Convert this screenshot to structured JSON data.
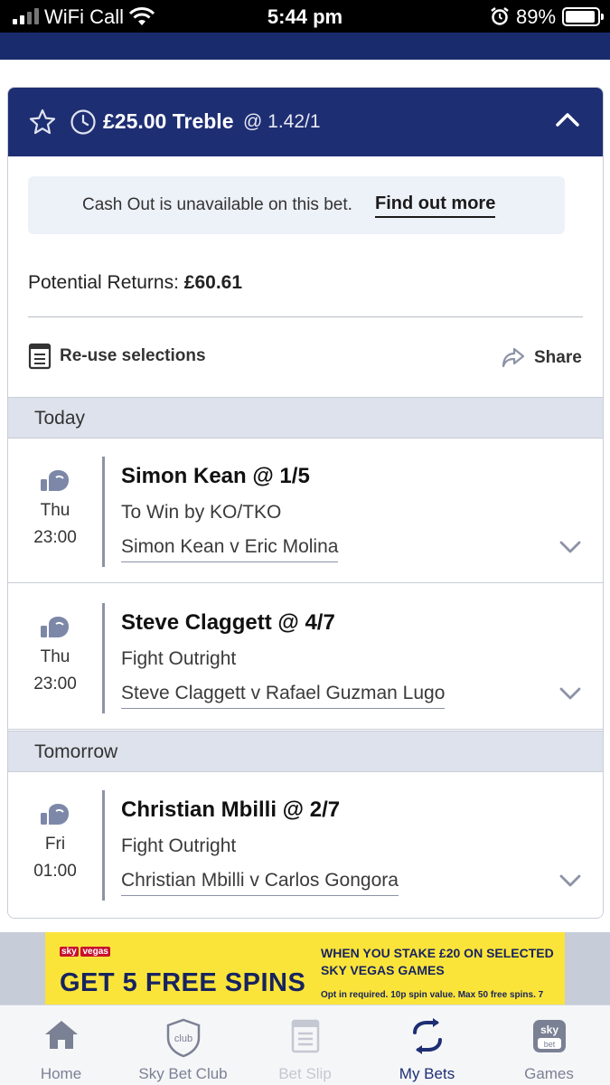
{
  "status_bar": {
    "carrier": "WiFi Call",
    "time": "5:44 pm",
    "battery": "89%",
    "icons": [
      "signal-icon",
      "wifi-icon",
      "alarm-icon",
      "battery-icon"
    ]
  },
  "bet": {
    "stake_type": "£25.00 Treble",
    "odds": "@ 1.42/1",
    "cashout_message": "Cash Out is unavailable on this bet.",
    "cashout_link": "Find out more",
    "returns_label": "Potential Returns:",
    "returns_value": "£60.61",
    "reuse_label": "Re-use selections",
    "share_label": "Share"
  },
  "groups": [
    {
      "label": "Today",
      "selections": [
        {
          "name": "Simon Kean @ 1/5",
          "market": "To Win by KO/TKO",
          "event": "Simon Kean v Eric Molina",
          "day": "Thu",
          "time": "23:00"
        },
        {
          "name": "Steve Claggett @ 4/7",
          "market": "Fight Outright",
          "event": "Steve Claggett v Rafael Guzman Lugo",
          "day": "Thu",
          "time": "23:00"
        }
      ]
    },
    {
      "label": "Tomorrow",
      "selections": [
        {
          "name": "Christian Mbilli @ 2/7",
          "market": "Fight Outright",
          "event": "Christian Mbilli v Carlos Gongora",
          "day": "Fri",
          "time": "01:00"
        }
      ]
    }
  ],
  "banner": {
    "brand_prefix": "sky",
    "brand_name": "vegas",
    "headline": "GET 5 FREE SPINS",
    "copy": "WHEN YOU STAKE £20 ON SELECTED SKY VEGAS GAMES",
    "small_print": "Opt in required. 10p spin value. Max 50 free spins. 7"
  },
  "tabs": [
    {
      "label": "Home",
      "icon": "home-icon",
      "state": "normal"
    },
    {
      "label": "Sky Bet Club",
      "icon": "club-shield-icon",
      "icon_text": "club",
      "state": "normal"
    },
    {
      "label": "Bet Slip",
      "icon": "betslip-icon",
      "state": "disabled"
    },
    {
      "label": "My Bets",
      "icon": "my-bets-icon",
      "state": "active"
    },
    {
      "label": "Games",
      "icon": "games-icon",
      "icon_text_top": "sky",
      "icon_text_bottom": "bet",
      "state": "normal"
    }
  ],
  "colors": {
    "header_navy": "#1e2e73",
    "day_band": "#dde2ec",
    "banner_yellow": "#fbe43a",
    "active_tab": "#1e2e73"
  }
}
